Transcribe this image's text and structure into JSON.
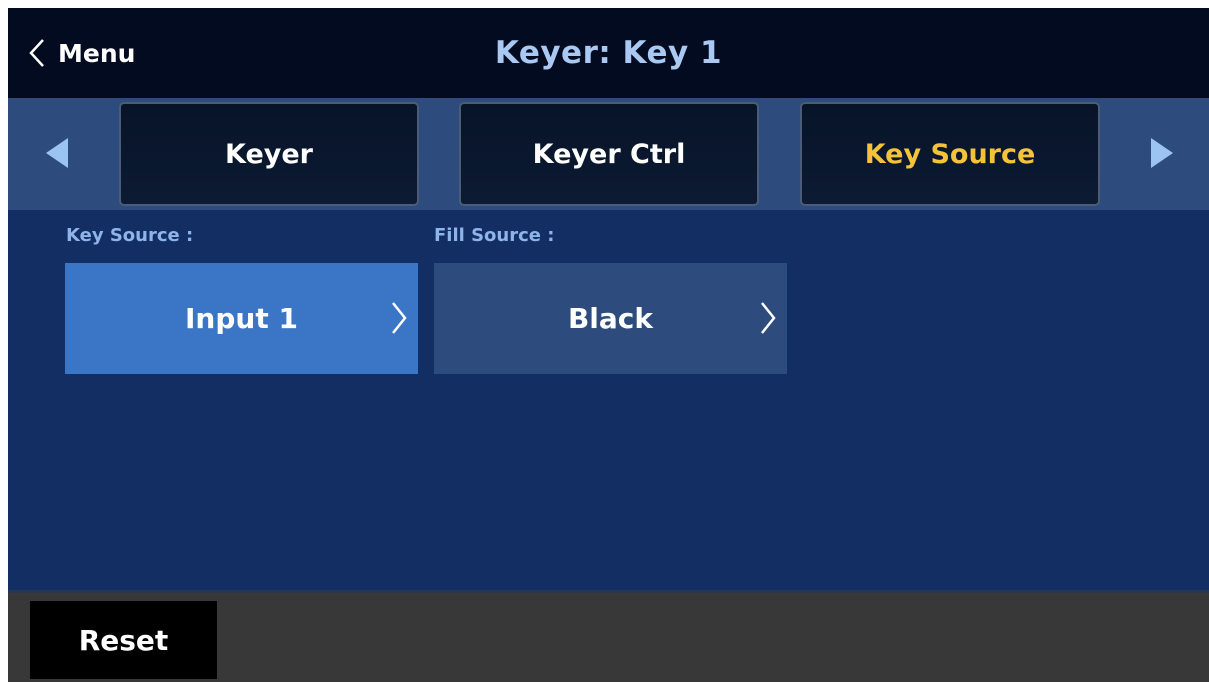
{
  "header": {
    "back_label": "Menu",
    "back_icon": "chevron-left-icon",
    "title": "Keyer: Key 1"
  },
  "tabs": [
    {
      "label": "Keyer",
      "active": false
    },
    {
      "label": "Keyer Ctrl",
      "active": false
    },
    {
      "label": "Key Source",
      "active": true
    }
  ],
  "tab_nav": {
    "prev_icon": "triangle-left-icon",
    "next_icon": "triangle-right-icon"
  },
  "fields": {
    "key_source": {
      "label": "Key Source :",
      "value": "Input 1"
    },
    "fill_source": {
      "label": "Fill Source :",
      "value": "Black"
    }
  },
  "footer": {
    "reset_label": "Reset"
  },
  "colors": {
    "title": "#a9c8f2",
    "active_tab": "#f5c33a",
    "selected_field": "#3b76c6",
    "field": "#2e4b7d",
    "background": "#122e63"
  }
}
